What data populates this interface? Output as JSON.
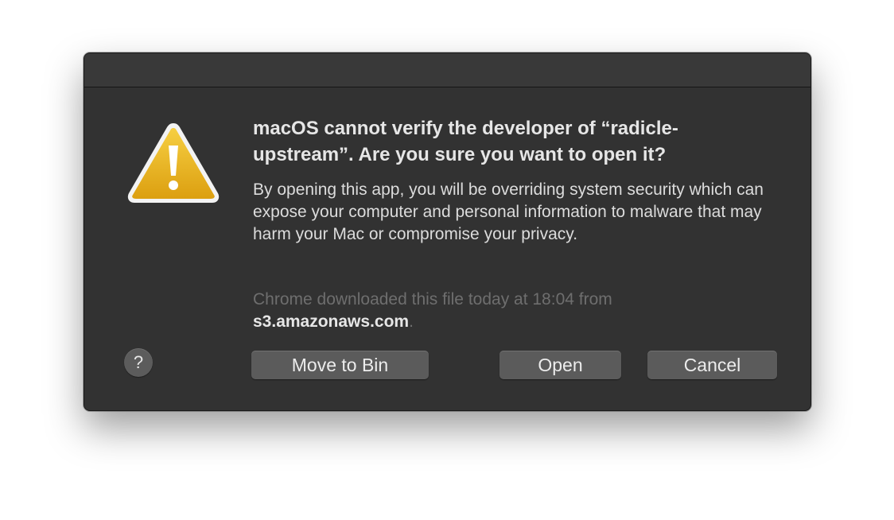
{
  "dialog": {
    "title": "macOS cannot verify the developer of “radicle-upstream”. Are you sure you want to open it?",
    "body": "By opening this app, you will be overriding system security which can expose your computer and personal information to malware that may harm your Mac or compromise your privacy.",
    "source_prefix": "Chrome downloaded this file today at 18:04 from",
    "source_domain": "s3.amazonaws.com",
    "source_suffix": "."
  },
  "buttons": {
    "help_label": "?",
    "move_to_bin_label": "Move to Bin",
    "open_label": "Open",
    "cancel_label": "Cancel"
  },
  "icons": {
    "warning": "warning-triangle-icon",
    "help": "question-mark-icon"
  },
  "colors": {
    "dialog_background": "#323232",
    "button_background": "#5b5b5b",
    "warning_yellow": "#e7ad1b"
  }
}
